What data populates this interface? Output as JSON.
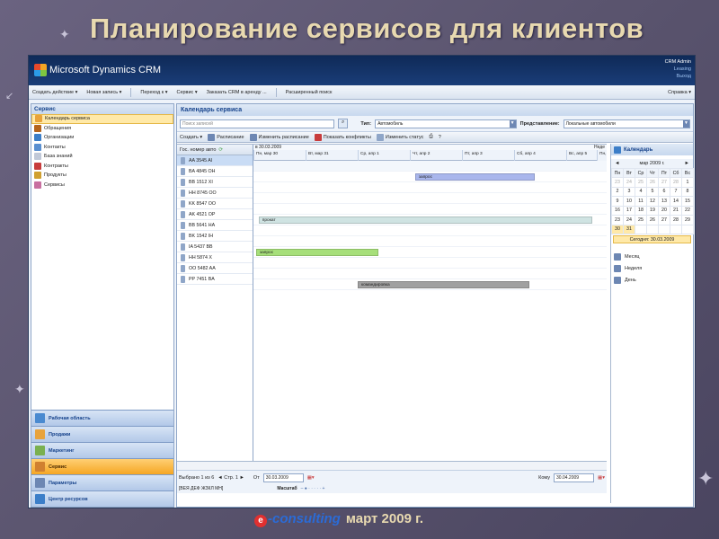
{
  "slide": {
    "title": "Планирование сервисов для клиентов",
    "footer_brand": "consulting",
    "footer_date": "март 2009 г."
  },
  "app": {
    "name": "Microsoft Dynamics CRM",
    "user_name": "CRM Admin",
    "user_org": "Leasing",
    "logout": "Выход"
  },
  "toolbar": {
    "create_activity": "Создать действие ▾",
    "new_record": "Новая запись ▾",
    "goto": "Переход к ▾",
    "service": "Сервис ▾",
    "order_crm": "Заказать CRM в аренду ...",
    "advanced_find": "Расширенный поиск",
    "help": "Справка ▾"
  },
  "left": {
    "header": "Сервис",
    "items": [
      {
        "label": "Календарь сервиса",
        "color": "#e8a33c"
      },
      {
        "label": "Обращения",
        "color": "#b5651d"
      },
      {
        "label": "Организации",
        "color": "#3c7ec8"
      },
      {
        "label": "Контакты",
        "color": "#5a8fd0"
      },
      {
        "label": "База знаний",
        "color": "#c0c8d8"
      },
      {
        "label": "Контракты",
        "color": "#c83c3c"
      },
      {
        "label": "Продукты",
        "color": "#d0a030"
      },
      {
        "label": "Сервисы",
        "color": "#c870a0"
      }
    ],
    "workareas": [
      {
        "label": "Рабочая область"
      },
      {
        "label": "Продажи"
      },
      {
        "label": "Маркетинг"
      },
      {
        "label": "Сервис"
      },
      {
        "label": "Параметры"
      },
      {
        "label": "Центр ресурсов"
      }
    ]
  },
  "main": {
    "header": "Календарь сервиса",
    "search_placeholder": "Поиск записей",
    "type_label": "Тип:",
    "type_value": "Автомобиль",
    "view_label": "Представление:",
    "view_value": "Локальные автомобили",
    "actions": [
      "Создать ▾",
      "Расписание",
      "Изменить расписание",
      "Показать конфликты",
      "Изменить статус"
    ],
    "res_header": "Гос. номер авто",
    "timeline_date": "в 30.03.2009",
    "right_col_label": "Неде",
    "right_col_sub": "Пн, а",
    "days": [
      "Пн, мар 30",
      "Вт, мар 31",
      "Ср, апр 1",
      "Чт, апр 2",
      "Пт, апр 3",
      "Сб, апр 4",
      "Вс, апр 5"
    ],
    "resources": [
      "AA 3545 AI",
      "BA 4845 OH",
      "BB 1512 XI",
      "HH 8745 OO",
      "KK 8547 OO",
      "AK 4521 OP",
      "BB 5641 HA",
      "BK 1542 IH",
      "IA 5437 BB",
      "HH 5874 X",
      "OO 5482 AA",
      "PP 7451 BA"
    ],
    "bars": [
      {
        "label": "запрос",
        "row": 1,
        "color": "#a9b6ec"
      },
      {
        "label": "прокат",
        "row": 5,
        "color": "#cfe3e2"
      },
      {
        "label": "запрос",
        "row": 8,
        "color": "#a6df7a"
      },
      {
        "label": "командировка",
        "row": 11,
        "color": "#a0a0a0"
      }
    ],
    "selected": "Выбрано 1 из 6",
    "page": "◄ Стр. 1 ►",
    "from_label": "От",
    "from_value": "30.03.2009",
    "to_label": "Кому",
    "to_value": "30.04.2009",
    "alphabet": "[ВЕЯ ДЕФ ЖЗКЛ МН]",
    "scale_label": "Масштаб",
    "scale_ctrl": "–  ● · · · · · +"
  },
  "calendar": {
    "title": "Календарь",
    "month": "мар 2009 г.",
    "prev": "◄",
    "next": "►",
    "weekdays": [
      "Пн",
      "Вт",
      "Ср",
      "Чт",
      "Пт",
      "Сб",
      "Вс"
    ],
    "weeks": [
      [
        "23",
        "24",
        "25",
        "26",
        "27",
        "28",
        "1"
      ],
      [
        "2",
        "3",
        "4",
        "5",
        "6",
        "7",
        "8"
      ],
      [
        "9",
        "10",
        "11",
        "12",
        "13",
        "14",
        "15"
      ],
      [
        "16",
        "17",
        "18",
        "19",
        "20",
        "21",
        "22"
      ],
      [
        "23",
        "24",
        "25",
        "26",
        "27",
        "28",
        "29"
      ],
      [
        "30",
        "31",
        "",
        "",
        "",
        "",
        ""
      ]
    ],
    "today": "Сегодня: 30.03.2009",
    "views": [
      "Месяц",
      "Неделя",
      "День"
    ]
  }
}
